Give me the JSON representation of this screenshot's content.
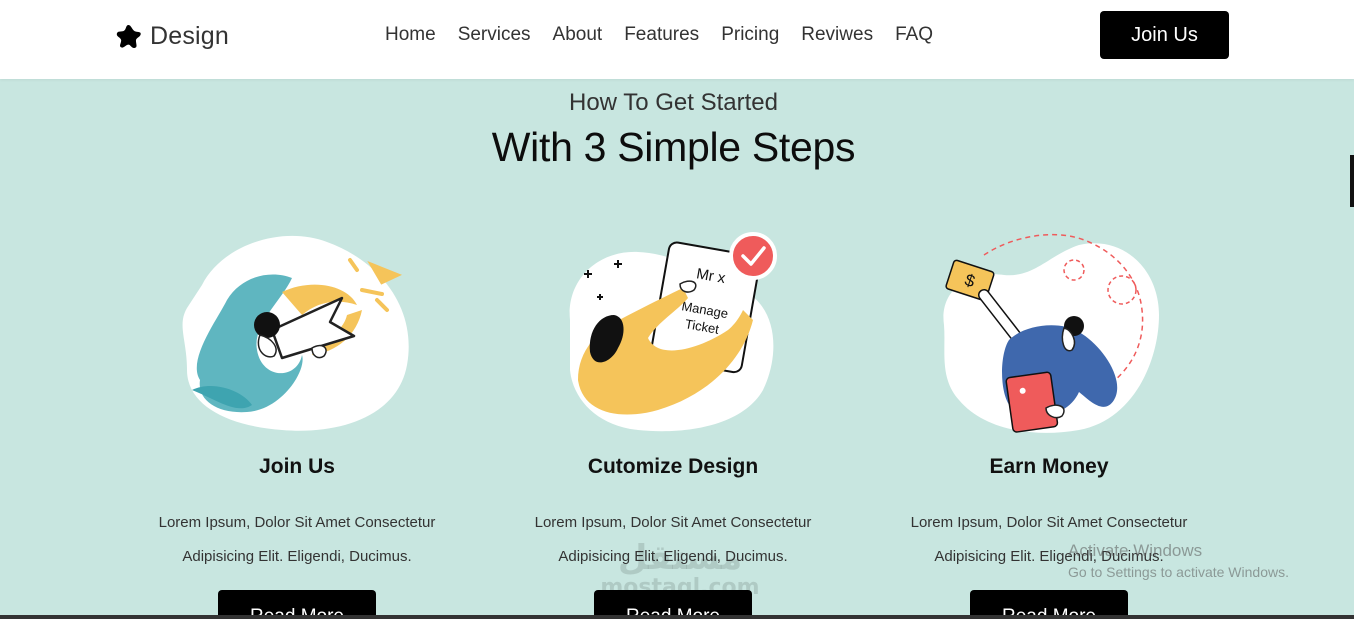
{
  "brand": {
    "name": "Design",
    "logo_icon": "star-blob-icon"
  },
  "nav": {
    "links": [
      "Home",
      "Services",
      "About",
      "Features",
      "Pricing",
      "Reviwes",
      "FAQ"
    ],
    "cta": "Join Us"
  },
  "section": {
    "kicker": "How To Get Started",
    "headline": "With 3 Simple Steps"
  },
  "steps": [
    {
      "title": "Join Us",
      "line1": "Lorem Ipsum, Dolor Sit Amet Consectetur",
      "line2": "Adipisicing Elit. Eligendi, Ducimus.",
      "button": "Read More",
      "illustration": "person-with-arrows-illustration"
    },
    {
      "title": "Cutomize Design",
      "line1": "Lorem Ipsum, Dolor Sit Amet Consectetur",
      "line2": "Adipisicing Elit. Eligendi, Ducimus.",
      "button": "Read More",
      "illustration": "manage-ticket-illustration",
      "card_title": "Mr x",
      "card_text_1": "Manage",
      "card_text_2": "Ticket"
    },
    {
      "title": "Earn Money",
      "line1": "Lorem Ipsum, Dolor Sit Amet Consectetur",
      "line2": "Adipisicing Elit. Eligendi, Ducimus.",
      "button": "Read More",
      "illustration": "person-holding-dollar-illustration",
      "note_symbol": "$"
    }
  ],
  "overlay": {
    "watermark_ar": "مستقل",
    "watermark_en": "mostaql.com",
    "activate_title": "Activate Windows",
    "activate_sub": "Go to Settings to activate Windows."
  },
  "colors": {
    "page_bg": "#c8e6e0",
    "nav_bg": "#ffffff",
    "button_bg": "#000000",
    "teal_figure": "#5fb6c0",
    "yellow_figure": "#f5c45a",
    "blue_figure": "#3f68ad",
    "red_accent": "#ef5b5b"
  }
}
